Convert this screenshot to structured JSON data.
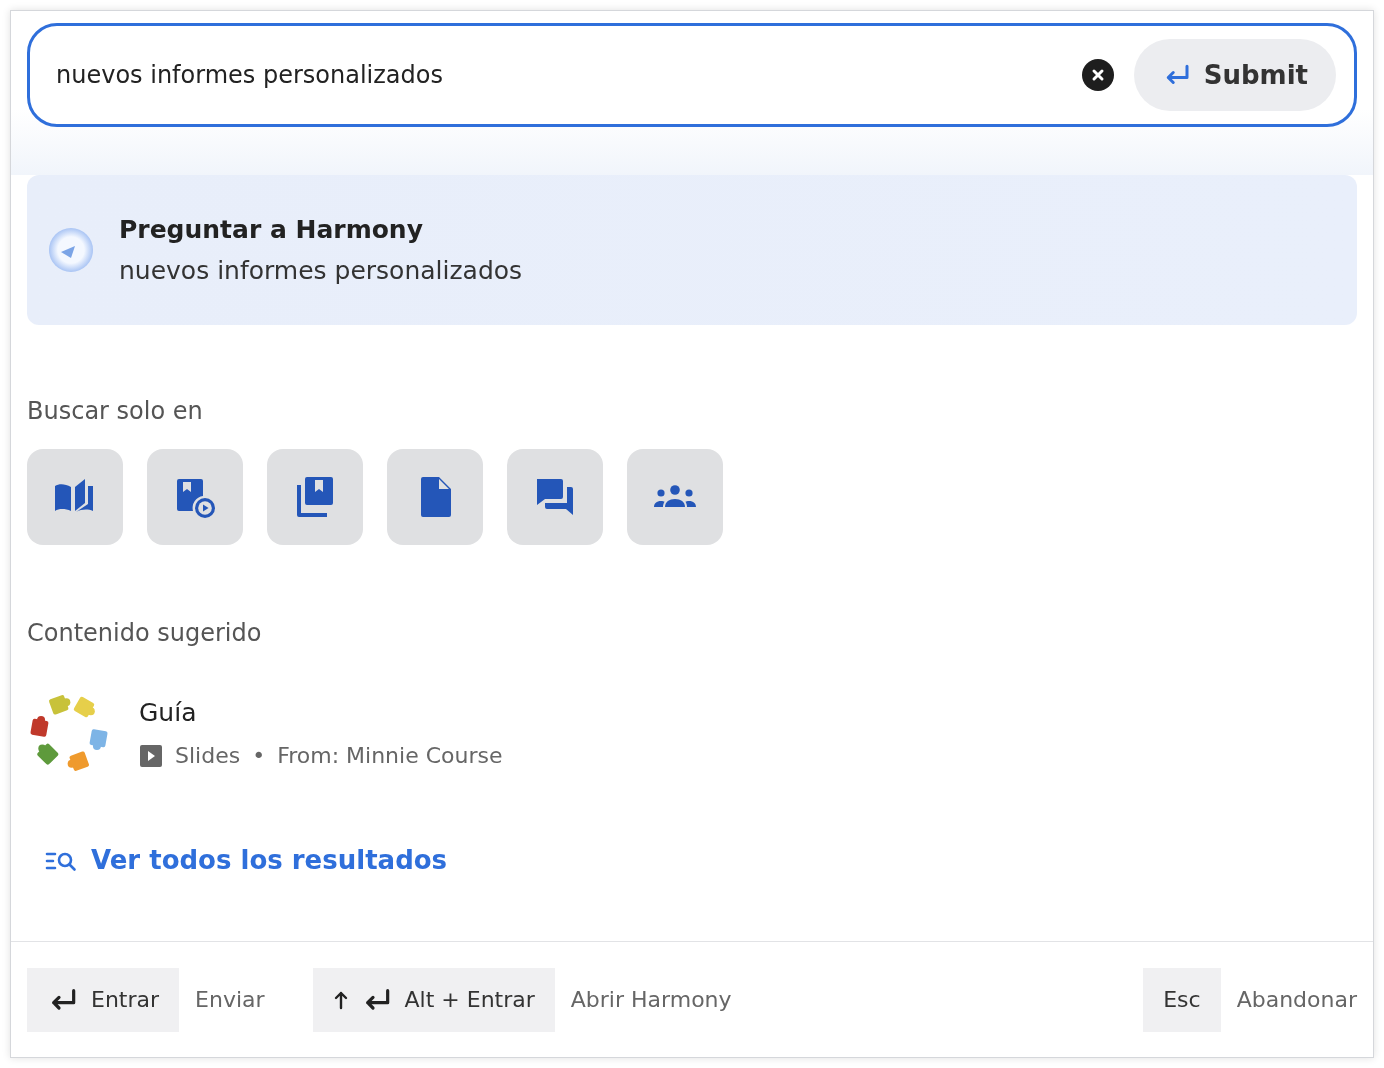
{
  "search": {
    "value": "nuevos informes personalizados",
    "submit_label": "Submit"
  },
  "ask": {
    "title": "Preguntar a Harmony",
    "query": "nuevos informes personalizados"
  },
  "filters": {
    "heading": "Buscar solo en",
    "items": [
      {
        "kind": "book"
      },
      {
        "kind": "media"
      },
      {
        "kind": "library"
      },
      {
        "kind": "document"
      },
      {
        "kind": "forum"
      },
      {
        "kind": "groups"
      }
    ]
  },
  "suggested": {
    "heading": "Contenido sugerido",
    "items": [
      {
        "title": "Guía",
        "type": "Slides",
        "separator": "•",
        "source": "From: Minnie Course"
      }
    ]
  },
  "view_all": "Ver todos los resultados",
  "shortcuts": [
    {
      "key": "Entrar",
      "icons": [
        {
          "kind": "enter"
        }
      ],
      "action": "Enviar"
    },
    {
      "key": "Alt + Entrar",
      "icons": [
        {
          "kind": "up"
        },
        {
          "kind": "enter"
        }
      ],
      "action": "Abrir Harmony"
    },
    {
      "key": "Esc",
      "action": "Abandonar"
    }
  ]
}
